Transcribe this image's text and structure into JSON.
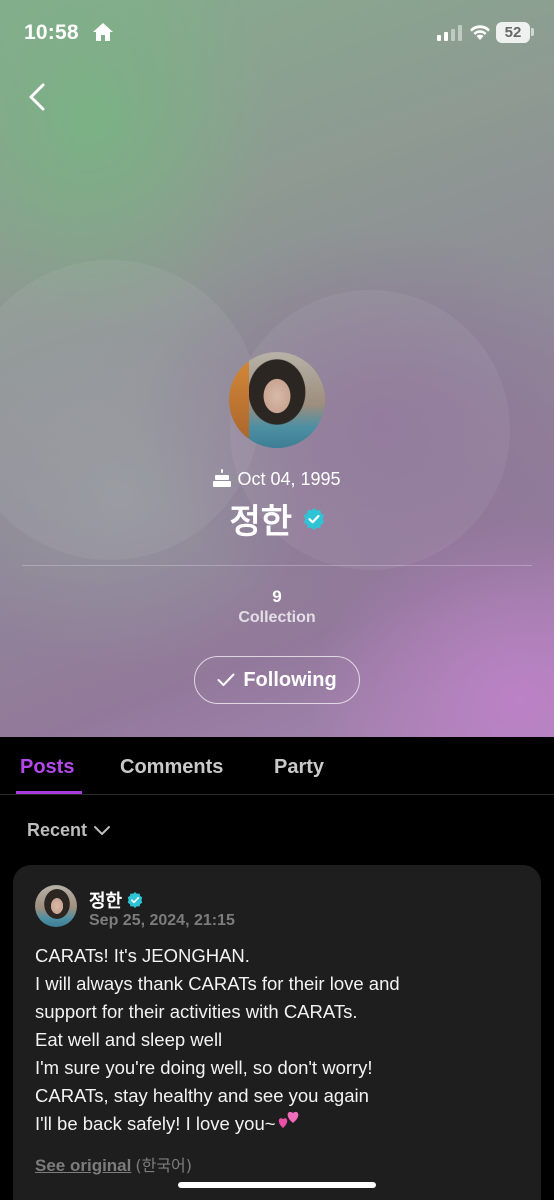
{
  "status_bar": {
    "time": "10:58",
    "battery": "52",
    "icons": [
      "home-icon",
      "signal-icon",
      "wifi-icon",
      "battery-icon"
    ]
  },
  "header": {
    "back_icon": "chevron-left-icon"
  },
  "profile": {
    "birthday": "Oct 04, 1995",
    "name": "정한",
    "verified": true,
    "collection_count": "9",
    "collection_label": "Collection",
    "follow_button_label": "Following"
  },
  "tabs": [
    {
      "label": "Posts",
      "active": true
    },
    {
      "label": "Comments",
      "active": false
    },
    {
      "label": "Party",
      "active": false
    }
  ],
  "sort": {
    "label": "Recent"
  },
  "post": {
    "author": "정한",
    "date": "Sep 25, 2024, 21:15",
    "lines": [
      "CARATs! It's JEONGHAN.",
      "I will always thank CARATs for their love and",
      "support for their activities with CARATs.",
      "Eat well and sleep well",
      "I'm sure you're doing well, so don't worry!",
      "CARATs, stay healthy and see you again",
      "I'll be back safely! I love you~"
    ],
    "see_original": "See original",
    "language": "(한국어)"
  },
  "colors": {
    "accent": "#b548ea",
    "verified": "#2ec4d6",
    "card_bg": "#1e1e1e"
  }
}
